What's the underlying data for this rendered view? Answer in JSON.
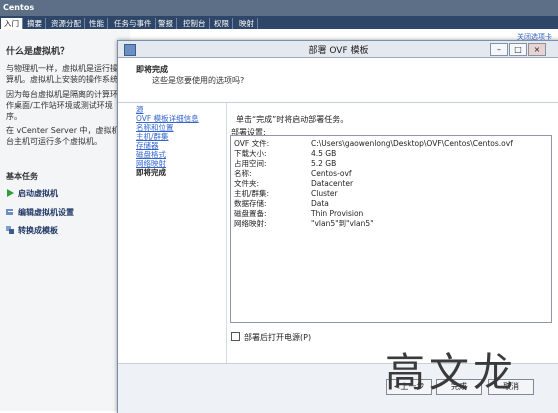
{
  "app": {
    "title": "Centos",
    "tabs": [
      "入门",
      "摘要",
      "资源分配",
      "性能",
      "任务与事件",
      "警报",
      "控制台",
      "权限",
      "映射"
    ],
    "close_tab_link": "关闭选项卡"
  },
  "background": {
    "heading": "什么是虚拟机？",
    "para1": "与物理机一样，虚拟机是运行操\n算机。虚拟机上安装的操作系统",
    "para2": "因为每台虚拟机是隔离的计算环\n作桌面/工作站环境或测试环境\n序。",
    "para3": "在 vCenter Server 中，虚拟机\n台主机可运行多个虚拟机。",
    "tasks_heading": "基本任务",
    "tasks": [
      "启动虚拟机",
      "编辑虚拟机设置",
      "转换成模板"
    ]
  },
  "dialog": {
    "title": "部署 OVF 模板",
    "step_title": "即将完成",
    "step_subtitle": "这些是您要使用的选项吗?",
    "nav": [
      "源",
      "OVF 模板详细信息",
      "名称和位置",
      "主机/群集",
      "存储器",
      "磁盘格式",
      "网络映射",
      "即将完成"
    ],
    "hint": "单击“完成”时将启动部署任务。",
    "summary_label": "部署设置:",
    "settings": [
      {
        "k": "OVF 文件:",
        "v": "C:\\Users\\gaowenlong\\Desktop\\OVF\\Centos\\Centos.ovf"
      },
      {
        "k": "下载大小:",
        "v": "4.5 GB"
      },
      {
        "k": "占用空间:",
        "v": "5.2 GB"
      },
      {
        "k": "名称:",
        "v": "Centos-ovf"
      },
      {
        "k": "文件夹:",
        "v": "Datacenter"
      },
      {
        "k": "主机/群集:",
        "v": "Cluster"
      },
      {
        "k": "数据存储:",
        "v": "Data"
      },
      {
        "k": "磁盘置备:",
        "v": "Thin Provision"
      },
      {
        "k": "网络映射:",
        "v": "\"vlan5\"到\"vlan5\""
      }
    ],
    "power_on_label": "部署后打开电源(P)",
    "buttons": {
      "back": "<上一步",
      "finish": "完成",
      "cancel": "取消"
    }
  },
  "watermark": "高文龙"
}
